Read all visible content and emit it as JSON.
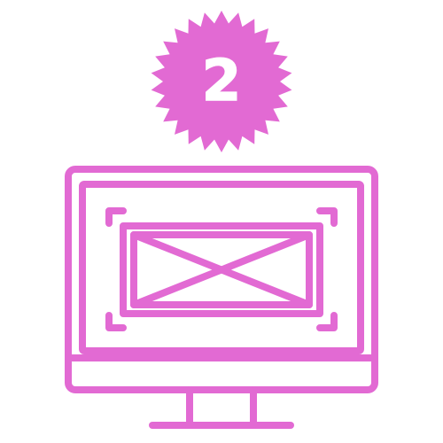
{
  "badge": {
    "number": "2"
  },
  "colors": {
    "accent": "#E26AD3",
    "background": "#FFFFFF",
    "badge_text": "#FFFFFF"
  },
  "icons": {
    "badge": "starburst-badge-icon",
    "monitor": "desktop-monitor-icon",
    "placeholder": "image-placeholder-icon",
    "corners": "focus-corner-brackets-icon"
  }
}
